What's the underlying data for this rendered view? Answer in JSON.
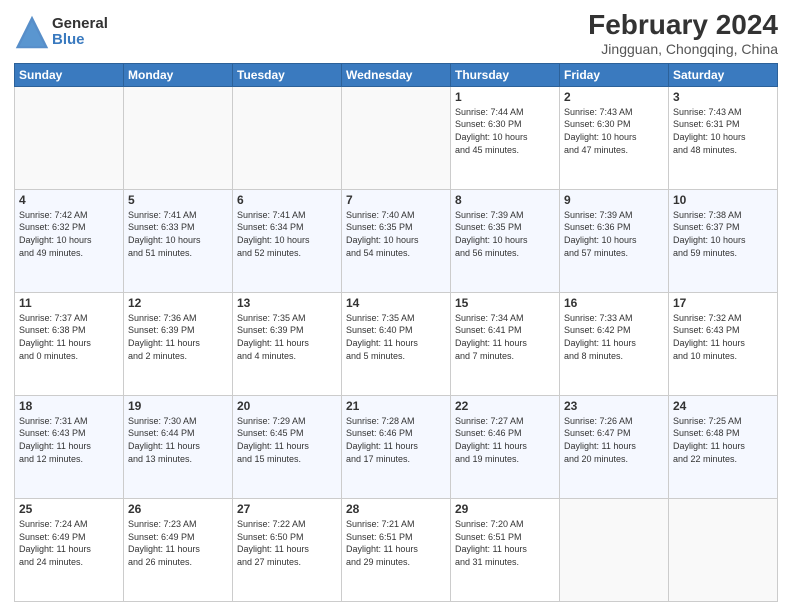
{
  "logo": {
    "general": "General",
    "blue": "Blue"
  },
  "title": "February 2024",
  "subtitle": "Jingguan, Chongqing, China",
  "days_of_week": [
    "Sunday",
    "Monday",
    "Tuesday",
    "Wednesday",
    "Thursday",
    "Friday",
    "Saturday"
  ],
  "weeks": [
    [
      {
        "day": "",
        "info": ""
      },
      {
        "day": "",
        "info": ""
      },
      {
        "day": "",
        "info": ""
      },
      {
        "day": "",
        "info": ""
      },
      {
        "day": "1",
        "info": "Sunrise: 7:44 AM\nSunset: 6:30 PM\nDaylight: 10 hours\nand 45 minutes."
      },
      {
        "day": "2",
        "info": "Sunrise: 7:43 AM\nSunset: 6:30 PM\nDaylight: 10 hours\nand 47 minutes."
      },
      {
        "day": "3",
        "info": "Sunrise: 7:43 AM\nSunset: 6:31 PM\nDaylight: 10 hours\nand 48 minutes."
      }
    ],
    [
      {
        "day": "4",
        "info": "Sunrise: 7:42 AM\nSunset: 6:32 PM\nDaylight: 10 hours\nand 49 minutes."
      },
      {
        "day": "5",
        "info": "Sunrise: 7:41 AM\nSunset: 6:33 PM\nDaylight: 10 hours\nand 51 minutes."
      },
      {
        "day": "6",
        "info": "Sunrise: 7:41 AM\nSunset: 6:34 PM\nDaylight: 10 hours\nand 52 minutes."
      },
      {
        "day": "7",
        "info": "Sunrise: 7:40 AM\nSunset: 6:35 PM\nDaylight: 10 hours\nand 54 minutes."
      },
      {
        "day": "8",
        "info": "Sunrise: 7:39 AM\nSunset: 6:35 PM\nDaylight: 10 hours\nand 56 minutes."
      },
      {
        "day": "9",
        "info": "Sunrise: 7:39 AM\nSunset: 6:36 PM\nDaylight: 10 hours\nand 57 minutes."
      },
      {
        "day": "10",
        "info": "Sunrise: 7:38 AM\nSunset: 6:37 PM\nDaylight: 10 hours\nand 59 minutes."
      }
    ],
    [
      {
        "day": "11",
        "info": "Sunrise: 7:37 AM\nSunset: 6:38 PM\nDaylight: 11 hours\nand 0 minutes."
      },
      {
        "day": "12",
        "info": "Sunrise: 7:36 AM\nSunset: 6:39 PM\nDaylight: 11 hours\nand 2 minutes."
      },
      {
        "day": "13",
        "info": "Sunrise: 7:35 AM\nSunset: 6:39 PM\nDaylight: 11 hours\nand 4 minutes."
      },
      {
        "day": "14",
        "info": "Sunrise: 7:35 AM\nSunset: 6:40 PM\nDaylight: 11 hours\nand 5 minutes."
      },
      {
        "day": "15",
        "info": "Sunrise: 7:34 AM\nSunset: 6:41 PM\nDaylight: 11 hours\nand 7 minutes."
      },
      {
        "day": "16",
        "info": "Sunrise: 7:33 AM\nSunset: 6:42 PM\nDaylight: 11 hours\nand 8 minutes."
      },
      {
        "day": "17",
        "info": "Sunrise: 7:32 AM\nSunset: 6:43 PM\nDaylight: 11 hours\nand 10 minutes."
      }
    ],
    [
      {
        "day": "18",
        "info": "Sunrise: 7:31 AM\nSunset: 6:43 PM\nDaylight: 11 hours\nand 12 minutes."
      },
      {
        "day": "19",
        "info": "Sunrise: 7:30 AM\nSunset: 6:44 PM\nDaylight: 11 hours\nand 13 minutes."
      },
      {
        "day": "20",
        "info": "Sunrise: 7:29 AM\nSunset: 6:45 PM\nDaylight: 11 hours\nand 15 minutes."
      },
      {
        "day": "21",
        "info": "Sunrise: 7:28 AM\nSunset: 6:46 PM\nDaylight: 11 hours\nand 17 minutes."
      },
      {
        "day": "22",
        "info": "Sunrise: 7:27 AM\nSunset: 6:46 PM\nDaylight: 11 hours\nand 19 minutes."
      },
      {
        "day": "23",
        "info": "Sunrise: 7:26 AM\nSunset: 6:47 PM\nDaylight: 11 hours\nand 20 minutes."
      },
      {
        "day": "24",
        "info": "Sunrise: 7:25 AM\nSunset: 6:48 PM\nDaylight: 11 hours\nand 22 minutes."
      }
    ],
    [
      {
        "day": "25",
        "info": "Sunrise: 7:24 AM\nSunset: 6:49 PM\nDaylight: 11 hours\nand 24 minutes."
      },
      {
        "day": "26",
        "info": "Sunrise: 7:23 AM\nSunset: 6:49 PM\nDaylight: 11 hours\nand 26 minutes."
      },
      {
        "day": "27",
        "info": "Sunrise: 7:22 AM\nSunset: 6:50 PM\nDaylight: 11 hours\nand 27 minutes."
      },
      {
        "day": "28",
        "info": "Sunrise: 7:21 AM\nSunset: 6:51 PM\nDaylight: 11 hours\nand 29 minutes."
      },
      {
        "day": "29",
        "info": "Sunrise: 7:20 AM\nSunset: 6:51 PM\nDaylight: 11 hours\nand 31 minutes."
      },
      {
        "day": "",
        "info": ""
      },
      {
        "day": "",
        "info": ""
      }
    ]
  ]
}
